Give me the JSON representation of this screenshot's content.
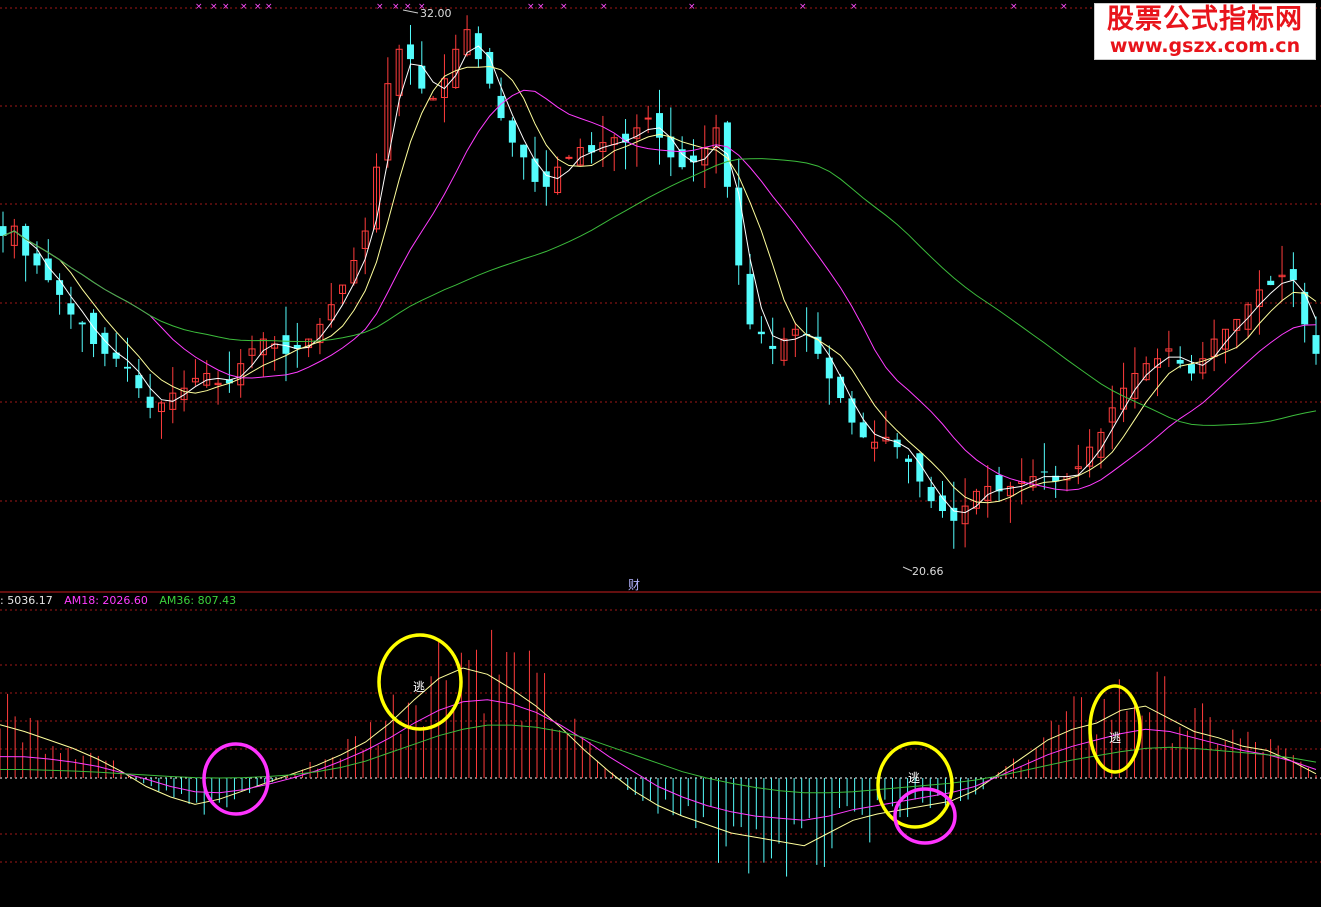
{
  "watermark": {
    "line1": "股票公式指标网",
    "line2": "www.gszx.com.cn"
  },
  "price_panel": {
    "high_label": "32.00",
    "low_label": "20.66",
    "panel_divider_label": "财"
  },
  "indicator_header": {
    "main_label": ": 5036.17",
    "am18_label": "AM18: 2026.60",
    "am36_label": "AM36: 807.43"
  },
  "signals": [
    {
      "text": "逃"
    },
    {
      "text": "逃"
    },
    {
      "text": "逃"
    }
  ],
  "colors": {
    "background": "#000000",
    "up_candle": "#ff3c3c",
    "down_candle": "#54fcfc",
    "ma_white": "#ffffff",
    "ma_yellow": "#ffff9c",
    "ma_magenta": "#ff3cff",
    "ma_green": "#3cbc3c",
    "grid": "#a01818",
    "highlight_yellow": "#ffff00",
    "highlight_magenta": "#ff33ff"
  },
  "chart_data": [
    {
      "type": "candlestick",
      "price_high": 32.0,
      "price_low": 20.66,
      "closes": [
        27.4,
        27.6,
        27.0,
        26.8,
        26.5,
        26.2,
        25.8,
        25.6,
        25.2,
        25.0,
        24.9,
        24.7,
        24.3,
        23.9,
        24.0,
        24.2,
        24.3,
        24.5,
        24.6,
        24.4,
        24.4,
        24.8,
        25.1,
        25.3,
        25.2,
        25.0,
        25.1,
        25.3,
        25.6,
        26.0,
        26.4,
        26.9,
        27.5,
        28.8,
        30.5,
        31.2,
        31.0,
        30.4,
        30.2,
        30.6,
        31.2,
        31.6,
        31.0,
        30.5,
        29.8,
        29.3,
        29.0,
        28.5,
        28.4,
        28.8,
        29.0,
        29.2,
        29.1,
        29.3,
        29.4,
        29.3,
        29.6,
        29.8,
        29.4,
        29.0,
        28.8,
        28.9,
        29.2,
        29.6,
        28.4,
        26.8,
        25.6,
        25.4,
        25.1,
        25.3,
        25.5,
        25.4,
        25.0,
        24.5,
        24.1,
        23.6,
        23.3,
        23.2,
        23.3,
        23.1,
        22.8,
        22.4,
        22.0,
        21.8,
        21.6,
        21.9,
        22.2,
        22.3,
        22.2,
        22.3,
        22.4,
        22.5,
        22.6,
        22.4,
        22.5,
        22.7,
        23.1,
        23.4,
        23.9,
        24.3,
        24.6,
        24.8,
        24.9,
        25.1,
        24.8,
        24.6,
        24.9,
        25.3,
        25.5,
        25.7,
        26.0,
        26.3,
        26.4,
        26.6,
        26.5,
        25.6,
        25.0
      ]
    },
    {
      "type": "line",
      "series": [
        {
          "name": "",
          "values": [
            5036,
            4400,
            3600,
            2800,
            1800,
            600,
            -800,
            -1800,
            -2500,
            -2000,
            -1200,
            -400,
            400,
            1200,
            2200,
            3400,
            5200,
            7400,
            9400,
            10400,
            9800,
            8400,
            6800,
            4800,
            2600,
            600,
            -1200,
            -2600,
            -3600,
            -4400,
            -5200,
            -5600,
            -6000,
            -6400,
            -5200,
            -4000,
            -3400,
            -3000,
            -2600,
            -2200,
            -1200,
            400,
            2000,
            3600,
            4600,
            5200,
            6400,
            6800,
            5600,
            4400,
            3800,
            3000,
            2600,
            1600,
            400
          ]
        },
        {
          "name": "AM18",
          "values": [
            2026,
            2000,
            1800,
            1500,
            1100,
            500,
            -100,
            -800,
            -1300,
            -1400,
            -1100,
            -600,
            0,
            700,
            1600,
            2600,
            3800,
            5200,
            6400,
            7200,
            7400,
            7000,
            6200,
            5000,
            3600,
            2000,
            600,
            -800,
            -1800,
            -2600,
            -3200,
            -3600,
            -3800,
            -4000,
            -3600,
            -3000,
            -2600,
            -2200,
            -1800,
            -1400,
            -800,
            200,
            1200,
            2200,
            3000,
            3600,
            4200,
            4600,
            4400,
            3800,
            3200,
            2600,
            2200,
            1600,
            800
          ]
        },
        {
          "name": "AM36",
          "values": [
            807,
            800,
            740,
            660,
            560,
            420,
            280,
            140,
            40,
            0,
            40,
            140,
            300,
            600,
            1000,
            1600,
            2400,
            3200,
            4000,
            4600,
            5000,
            5000,
            4800,
            4400,
            3800,
            3000,
            2200,
            1400,
            600,
            0,
            -500,
            -900,
            -1200,
            -1400,
            -1400,
            -1300,
            -1100,
            -900,
            -700,
            -500,
            -200,
            200,
            700,
            1200,
            1700,
            2100,
            2500,
            2800,
            2900,
            2800,
            2600,
            2400,
            2200,
            1900,
            1500
          ]
        }
      ]
    }
  ]
}
